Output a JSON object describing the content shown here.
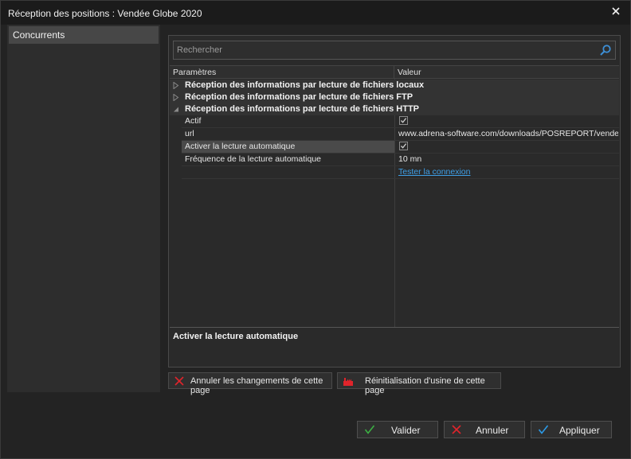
{
  "window": {
    "title": "Réception des positions : Vendée Globe 2020"
  },
  "sidebar": {
    "items": [
      {
        "label": "Concurrents"
      }
    ]
  },
  "search": {
    "placeholder": "Rechercher"
  },
  "grid": {
    "columns": [
      "Paramètres",
      "Valeur"
    ],
    "categories": [
      {
        "label": "Réception des informations par lecture de fichiers locaux",
        "expanded": false
      },
      {
        "label": "Réception des informations par lecture de fichiers FTP",
        "expanded": false
      },
      {
        "label": "Réception des informations par lecture de fichiers HTTP",
        "expanded": true
      }
    ],
    "properties": [
      {
        "label": "Actif",
        "type": "checkbox",
        "checked": true
      },
      {
        "label": "url",
        "value": "www.adrena-software.com/downloads/POSREPORT/vendeeg..."
      },
      {
        "label": "Activer la lecture automatique",
        "type": "checkbox",
        "checked": true,
        "selected": true
      },
      {
        "label": "Fréquence de la lecture automatique",
        "value": "10 mn"
      },
      {
        "label": "",
        "link": "Tester la connexion"
      }
    ]
  },
  "description": {
    "title": "Activer la lecture automatique"
  },
  "actions": {
    "revert_label": "Annuler les changements de cette page",
    "reset_label": "Réinitialisation d'usine de cette page"
  },
  "footer": {
    "validate_label": "Valider",
    "cancel_label": "Annuler",
    "apply_label": "Appliquer"
  },
  "colors": {
    "accent_green": "#3cb043",
    "accent_red": "#e0242b",
    "accent_blue": "#2c9be8",
    "link": "#3fa0e8"
  },
  "icons": {
    "close": "close-icon",
    "search": "search-icon",
    "check": "check-icon",
    "cross": "cross-icon",
    "reset": "factory-reset-icon"
  }
}
